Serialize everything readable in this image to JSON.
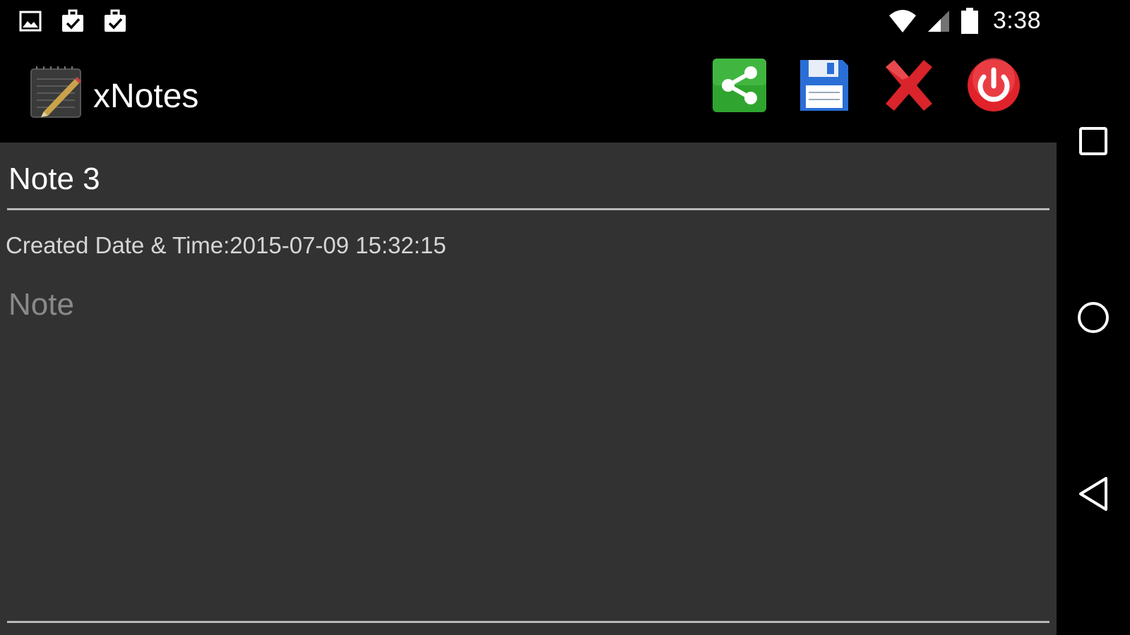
{
  "status_bar": {
    "left_icons": [
      "image-notification-icon",
      "clipboard-check-icon",
      "clipboard-check-icon"
    ],
    "right_icons": [
      "wifi-icon",
      "signal-icon",
      "battery-icon"
    ],
    "time": "3:38"
  },
  "action_bar": {
    "app_icon": "notepad-pencil-icon",
    "title": "xNotes",
    "actions": [
      {
        "name": "share-button",
        "icon": "share-icon",
        "color": "#2fa52f"
      },
      {
        "name": "save-button",
        "icon": "floppy-disk-icon",
        "color": "#2a6fd6"
      },
      {
        "name": "delete-button",
        "icon": "red-x-icon",
        "color": "#d8242a"
      },
      {
        "name": "power-button",
        "icon": "power-icon",
        "color": "#e0222a"
      }
    ]
  },
  "note": {
    "title_value": "Note 3",
    "created_label": "Created Date & Time:2015-07-09 15:32:15",
    "body_placeholder": "Note"
  },
  "nav_bar": {
    "buttons": [
      "recents-button",
      "home-button",
      "back-button"
    ]
  },
  "colors": {
    "background": "#000000",
    "content_bg": "#323232",
    "underline": "#b8b8b8"
  }
}
